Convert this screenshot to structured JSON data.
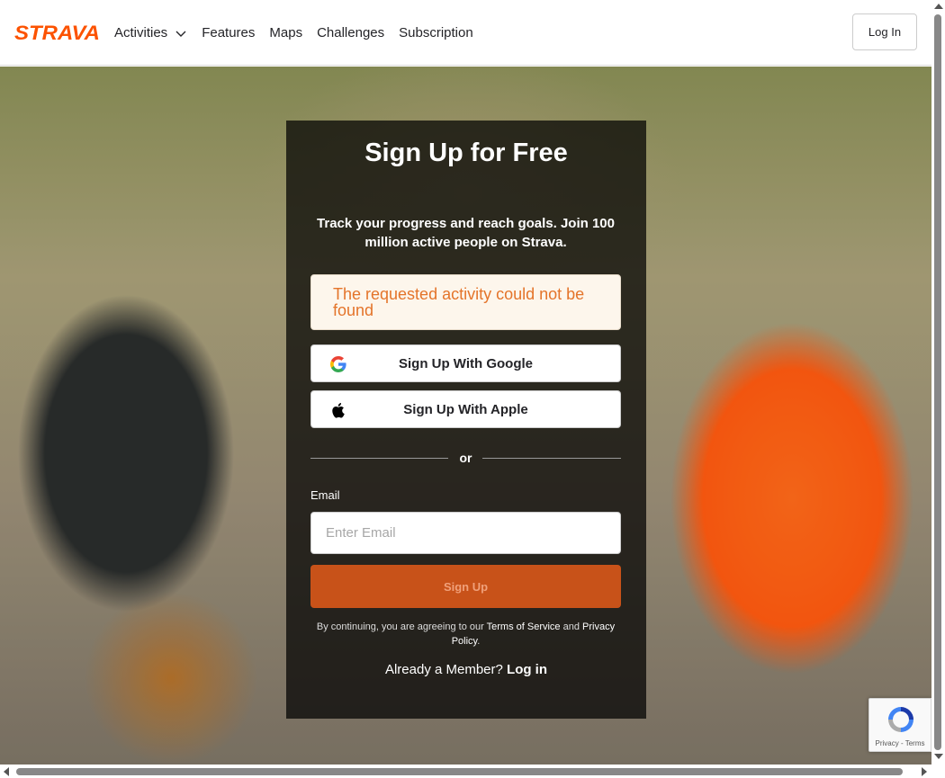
{
  "brand": {
    "name": "STRAVA",
    "color": "#fc5200"
  },
  "nav": {
    "items": [
      {
        "label": "Activities",
        "has_dropdown": true
      },
      {
        "label": "Features"
      },
      {
        "label": "Maps"
      },
      {
        "label": "Challenges"
      },
      {
        "label": "Subscription"
      }
    ],
    "login_label": "Log In"
  },
  "signup": {
    "title": "Sign Up for Free",
    "subtitle": "Track your progress and reach goals. Join 100 million active people on Strava.",
    "alert": "The requested activity could not be found",
    "google_label": "Sign Up With Google",
    "apple_label": "Sign Up With Apple",
    "or_label": "or",
    "email_label": "Email",
    "email_placeholder": "Enter Email",
    "email_value": "",
    "submit_label": "Sign Up",
    "terms_prefix": "By continuing, you are agreeing to our",
    "terms_link": "Terms of Service",
    "terms_and": "and",
    "privacy_link": "Privacy Policy",
    "terms_suffix": ".",
    "member_prefix": "Already a Member?",
    "member_link": "Log in"
  },
  "recaptcha": {
    "text": "Privacy - Terms"
  },
  "colors": {
    "accent": "#fc5200",
    "alert_text": "#e4742a",
    "alert_bg": "#fdf6ec"
  }
}
